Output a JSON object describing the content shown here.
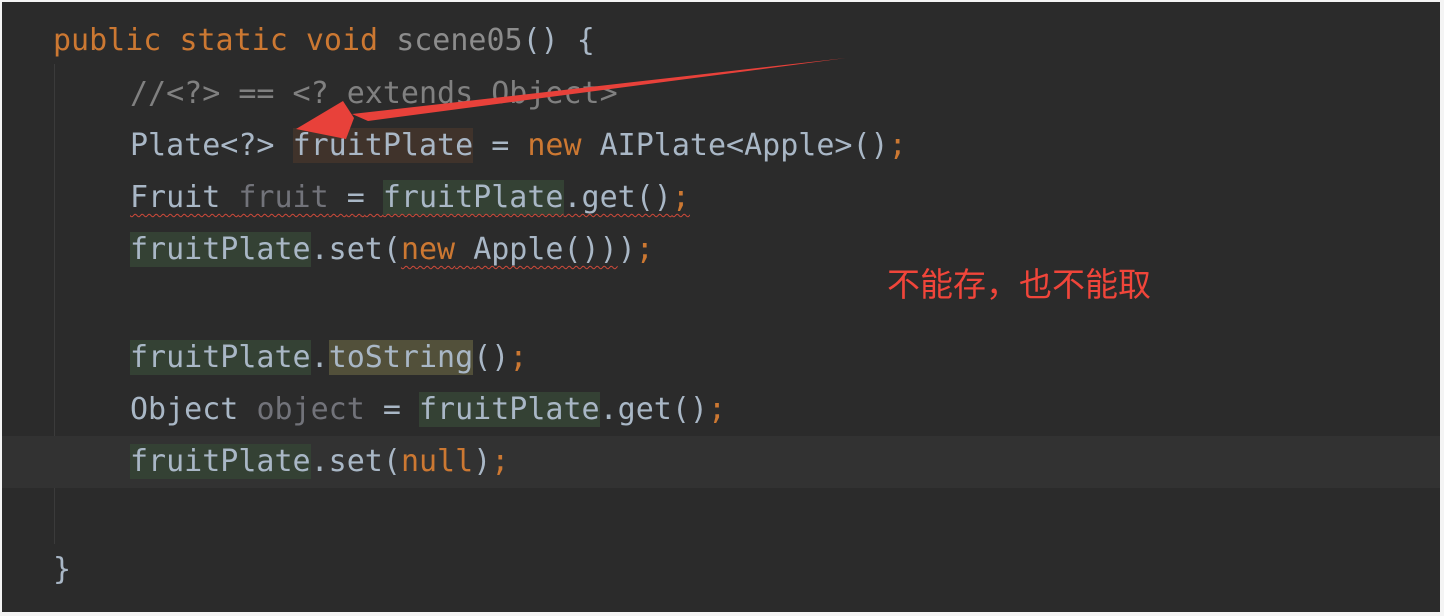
{
  "code": {
    "line1": {
      "kw_public": "public",
      "kw_static": "static",
      "kw_void": "void",
      "method": "scene05",
      "tail": "() {"
    },
    "line2": {
      "comment": "//<?> == <? extends Object>"
    },
    "line3": {
      "type": "Plate<?>",
      "var": "fruitPlate",
      "eq": "=",
      "kw_new": "new",
      "ctor": "AIPlate<Apple>()",
      "semi": ";"
    },
    "line4": {
      "type": "Fruit",
      "var": "fruit",
      "eq": "=",
      "recv": "fruitPlate",
      "call": ".get()",
      "semi": ";"
    },
    "line5": {
      "recv": "fruitPlate",
      "call": ".set(",
      "kw_new": "new",
      "arg": "Apple())",
      "close": ")",
      "semi": ";"
    },
    "line7": {
      "recv": "fruitPlate",
      "dot": ".",
      "method": "toString",
      "args": "()",
      "semi": ";"
    },
    "line8": {
      "type": "Object",
      "var": "object",
      "eq": "=",
      "recv": "fruitPlate",
      "call": ".get()",
      "semi": ";"
    },
    "line9": {
      "recv": "fruitPlate",
      "call": ".set(",
      "kw_null": "null",
      "close": ")",
      "semi": ";"
    },
    "line11": {
      "brace": "}"
    }
  },
  "annotation": {
    "text": "不能存，也不能取"
  },
  "colors": {
    "background": "#2b2b2b",
    "keyword": "#cc7832",
    "default_text": "#a9b7c6",
    "comment": "#808080",
    "annotation": "#f0453a",
    "arrow": "#e8413a"
  }
}
